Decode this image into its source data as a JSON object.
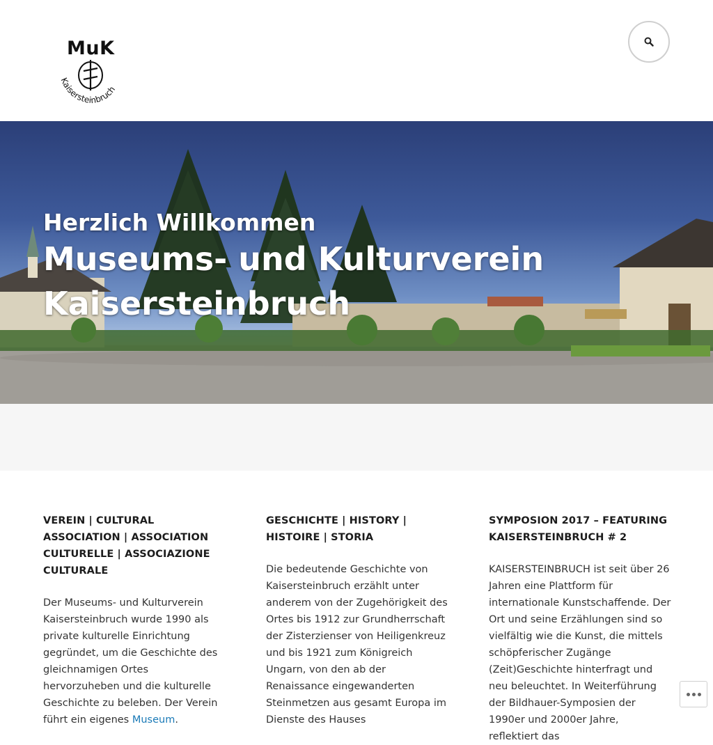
{
  "header": {
    "logo_title": "MuK",
    "logo_subtitle": "Kaisersteinbruch",
    "search_icon": "search-icon"
  },
  "hero": {
    "kicker": "Herzlich Willkommen",
    "title_line1": "Museums- und Kulturverein",
    "title_line2": "Kaisersteinbruch"
  },
  "columns": [
    {
      "title": "VEREIN | CULTURAL ASSOCIATION | ASSOCIATION CULTURELLE | ASSOCIAZIONE CULTURALE",
      "text": "Der Museums- und Kulturverein Kaisersteinbruch wurde 1990 als private kulturelle Einrichtung gegründet, um die Geschichte des gleichnamigen Ortes hervorzuheben und die kulturelle Geschichte zu beleben. Der Verein führt ein eigenes ",
      "link": "Museum",
      "text_after": "."
    },
    {
      "title": "GESCHICHTE | HISTORY | HISTOIRE | STORIA",
      "text": "Die bedeutende Geschichte von Kaisersteinbruch erzählt unter anderem von der Zugehörigkeit des Ortes bis 1912 zur Grundherrschaft der Zisterzienser von Heiligenkreuz und bis 1921 zum Königreich Ungarn, von den ab der Renaissance eingewanderten Steinmetzen aus gesamt Europa im Dienste des Hauses"
    },
    {
      "title": "SYMPOSION 2017 – FEATURING KAISERSTEINBRUCH # 2",
      "text": "KAISERSTEINBRUCH ist seit über 26 Jahren eine Plattform für internationale Kunstschaffende. Der Ort und seine Erzählungen sind so vielfältig wie die Kunst, die mittels schöpferischer Zugänge (Zeit)Geschichte hinterfragt und neu beleuchtet. In Weiterführung der Bildhauer-Symposien der 1990er und 2000er Jahre, reflektiert das"
    }
  ],
  "more_button_icon": "ellipsis-icon"
}
